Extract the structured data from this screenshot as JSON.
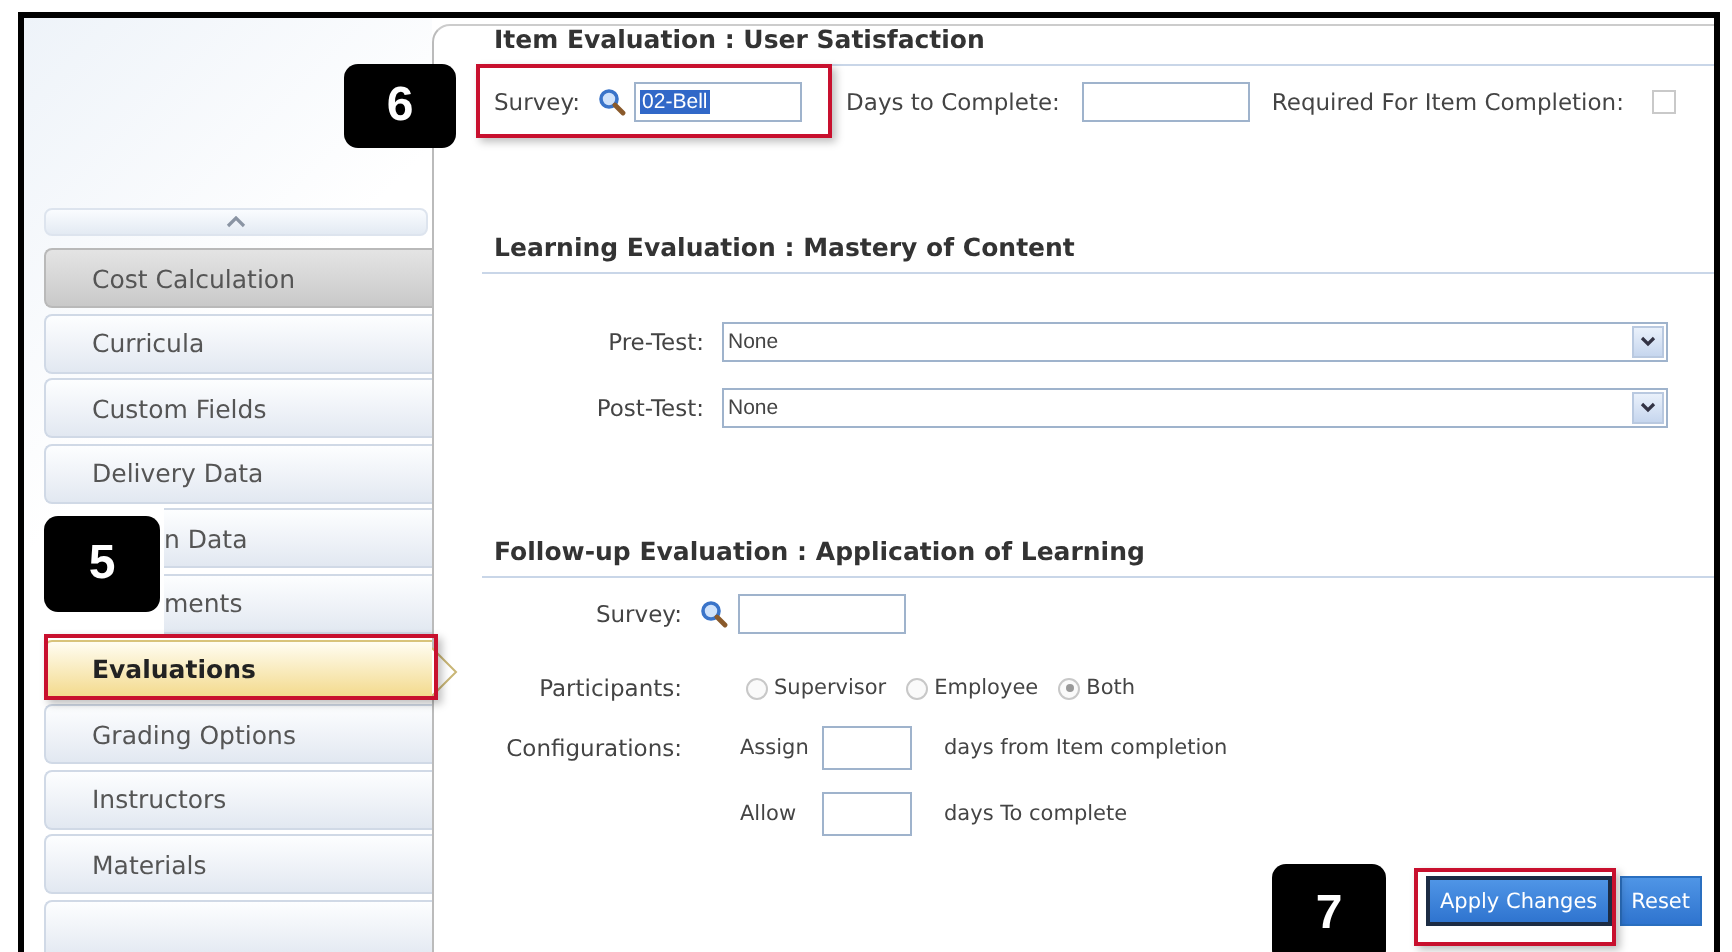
{
  "sidebar": {
    "items": [
      {
        "label": "Cost Calculation",
        "kind": "full",
        "selected": false,
        "hovered": true,
        "highlighted": false
      },
      {
        "label": "Curricula",
        "kind": "full",
        "selected": false,
        "hovered": false,
        "highlighted": false
      },
      {
        "label": "Custom Fields",
        "kind": "full",
        "selected": false,
        "hovered": false,
        "highlighted": false
      },
      {
        "label": "Delivery Data",
        "kind": "full",
        "selected": false,
        "hovered": false,
        "highlighted": false
      },
      {
        "label": "n Data",
        "kind": "partial",
        "selected": false,
        "hovered": false,
        "highlighted": false
      },
      {
        "label": "ments",
        "kind": "partial",
        "selected": false,
        "hovered": false,
        "highlighted": false
      },
      {
        "label": "Evaluations",
        "kind": "full",
        "selected": true,
        "hovered": false,
        "highlighted": true
      },
      {
        "label": "Grading Options",
        "kind": "full",
        "selected": false,
        "hovered": false,
        "highlighted": false
      },
      {
        "label": "Instructors",
        "kind": "full",
        "selected": false,
        "hovered": false,
        "highlighted": false
      },
      {
        "label": "Materials",
        "kind": "full",
        "selected": false,
        "hovered": false,
        "highlighted": false
      },
      {
        "kind": "cut",
        "selected": false,
        "hovered": false,
        "highlighted": false
      }
    ]
  },
  "item_evaluation": {
    "title": "Item Evaluation : User Satisfaction",
    "survey_label": "Survey:",
    "survey_value": "02-Bell",
    "survey_highlighted": true,
    "days_label": "Days to Complete:",
    "required_label": "Required For Item Completion:",
    "required_checked": false
  },
  "learning_evaluation": {
    "title": "Learning Evaluation : Mastery of Content",
    "fields": [
      {
        "label": "Pre-Test:",
        "value": "None"
      },
      {
        "label": "Post-Test:",
        "value": "None"
      }
    ]
  },
  "followup_evaluation": {
    "title": "Follow-up Evaluation : Application of Learning",
    "survey_label": "Survey:",
    "participants_label": "Participants:",
    "participants": [
      {
        "label": "Supervisor",
        "selected": false
      },
      {
        "label": "Employee",
        "selected": false
      },
      {
        "label": "Both",
        "selected": true
      }
    ],
    "configurations_label": "Configurations:",
    "configurations": [
      {
        "prefix": "Assign",
        "suffix": "days from Item completion"
      },
      {
        "prefix": "Allow",
        "suffix": "days To complete"
      }
    ]
  },
  "buttons": [
    {
      "label": "Apply Changes",
      "focused": true,
      "highlighted": true
    },
    {
      "label": "Reset",
      "focused": false,
      "highlighted": false
    }
  ],
  "callouts": [
    "6",
    "5",
    "7"
  ]
}
